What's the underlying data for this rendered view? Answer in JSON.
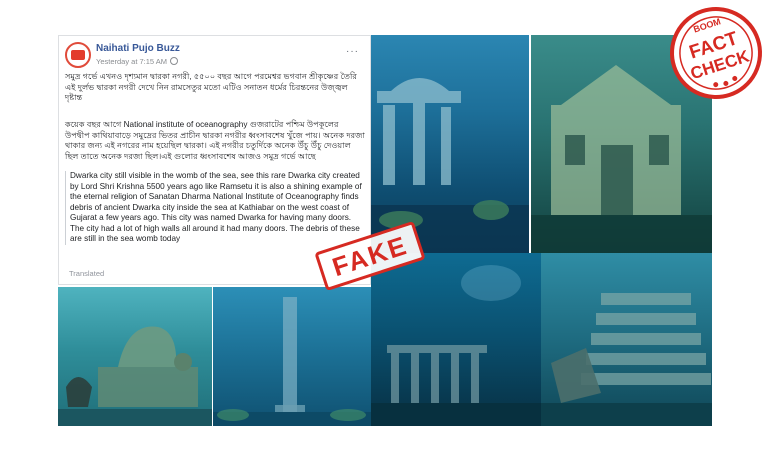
{
  "post": {
    "page_name": "Naihati Pujo Buzz",
    "timestamp": "Yesterday at 7:15 AM",
    "menu": "···",
    "bengali_p1": "সমুদ্র গর্ভে এখনও দৃশ্যমান দ্বারকা নগরী, ৫৫০০ বছর আগে পরমেশ্বর ভগবান শ্রীকৃষ্ণের তৈরি এই দুর্লভ দ্বারকা নগরী দেখে নিন রামসেতুর মতো এটিও সনাতন ধর্মের চিরন্তনের উজ্জ্বল দৃষ্টান্ত",
    "bengali_p2": "কয়েক বছর আগে National institute of oceanography গুজরাটের পশ্চিম উপকূলের উপদ্বীপ কাথিয়াবাড়ে সমুদ্রের ভিতর প্রাচীন দ্বারকা নগরীর ধ্বংসাবশেষ খুঁজে পায়। অনেক দরজা থাকার জন্য এই নগরের নাম হয়েছিল দ্বারকা। এই নগরীর চতুর্দিকে অনেক উঁচু উঁচু দেওয়াল ছিল তাতে অনেক দরজা ছিল।এই গুলোর ধ্বংসাবশেষ আজও সমুদ্র গর্ভে আছে",
    "translation": "Dwarka city still visible in the womb of the sea, see this rare Dwarka city created by Lord Shri Krishna 5500 years ago like Ramsetu it is also a shining example of the eternal religion of Sanatan Dharma National Institute of Oceanography finds debris of ancient Dwarka city inside the sea at Kathiabar on the west coast of Gujarat a few years ago. This city was named Dwarka for having many doors. The city had a lot of high walls all around it had many doors. The debris of these are still in the sea womb today",
    "translated_label": "Translated"
  },
  "stamps": {
    "fake": "FAKE",
    "boom": "BOOM",
    "fact": "FACT",
    "check": "CHECK"
  },
  "colors": {
    "link_blue": "#385898",
    "stamp_red": "#d62a22"
  }
}
